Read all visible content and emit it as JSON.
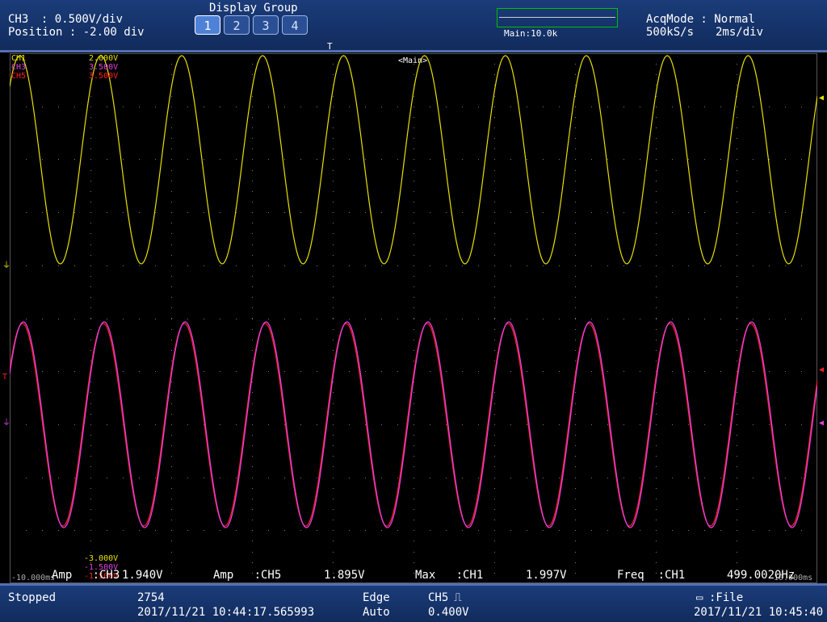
{
  "header": {
    "channel": "CH3",
    "scale_label": "  : 0.500V/div",
    "position_label": "Position : -2.00 div",
    "display_group_title": "Display Group",
    "display_group_buttons": [
      "1",
      "2",
      "3",
      "4"
    ],
    "display_group_active": "1",
    "zoom_label": "Main:10.0k",
    "acq_mode": "AcqMode : Normal",
    "sample_rate": "500kS/s",
    "timebase": "2ms/div"
  },
  "screen": {
    "main_tag": "<Main>",
    "trigger_marker": "T",
    "channels": [
      {
        "name": "CH1",
        "top": "2.000V",
        "bottom": "-3.000V",
        "color": "#e8e000"
      },
      {
        "name": "CH3",
        "top": "3.500V",
        "bottom": "-1.500V",
        "color": "#e040e0"
      },
      {
        "name": "CH5",
        "top": "3.500V",
        "bottom": "-1.500V",
        "color": "#ff2020"
      }
    ],
    "time_start": "-10.000ms",
    "time_end": "10.000ms"
  },
  "measurements": [
    {
      "label": "Amp   :CH3",
      "value": "1.940V"
    },
    {
      "label": "Amp   :CH5",
      "value": "1.895V"
    },
    {
      "label": "Max   :CH1",
      "value": "1.997V"
    },
    {
      "label": "Freq  :CH1",
      "value": "499.0020Hz"
    }
  ],
  "status": {
    "state": "Stopped",
    "acq_count": "2754",
    "acq_time": "2017/11/21 10:44:17.565993",
    "trigger_type": "Edge",
    "trigger_mode": "Auto",
    "trigger_source": "CH5",
    "trigger_level": "0.400V",
    "save_label": ":File",
    "clock": "2017/11/21 10:45:40"
  },
  "chart_data": {
    "type": "line",
    "xlabel": "",
    "ylabel": "",
    "xlim": [
      -10,
      10
    ],
    "series": [
      {
        "name": "CH1",
        "frequency_hz": 499.002,
        "max_v": 1.997,
        "color": "#e8e000"
      },
      {
        "name": "CH3",
        "amplitude_v": 1.94,
        "frequency_hz": 499.002,
        "color": "#e040e0"
      },
      {
        "name": "CH5",
        "amplitude_v": 1.895,
        "frequency_hz": 499.002,
        "color": "#ff2020"
      }
    ]
  }
}
